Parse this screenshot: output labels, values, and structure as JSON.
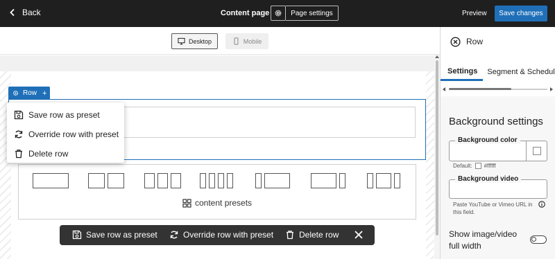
{
  "topbar": {
    "back_label": "Back",
    "page_title": "Content page",
    "page_settings_label": "Page settings",
    "preview_label": "Preview",
    "save_label": "Save changes",
    "accent_color": "#1f6fb8"
  },
  "device_switcher": {
    "desktop_label": "Desktop",
    "mobile_label": "Mobile",
    "selected": "Desktop"
  },
  "row_tab": {
    "label": "Row"
  },
  "context_menu": {
    "items": [
      {
        "label": "Save row as preset",
        "icon": "save-icon"
      },
      {
        "label": "Override row with preset",
        "icon": "sync-icon"
      },
      {
        "label": "Delete row",
        "icon": "trash-icon"
      }
    ]
  },
  "presets": {
    "label": "content presets",
    "layouts": [
      "1",
      "1-1",
      "1-1-1",
      "1-1-1-1",
      "1-3",
      "3-1",
      "1-2-1"
    ]
  },
  "bottom_toolbar": {
    "save_preset_label": "Save row as preset",
    "override_label": "Override row with preset",
    "delete_label": "Delete row"
  },
  "panel": {
    "title": "Row",
    "tabs": [
      {
        "label": "Settings",
        "active": true
      },
      {
        "label": "Segment & Schedule",
        "active": false
      }
    ],
    "section_heading": "Background settings",
    "background_color": {
      "label": "Background color",
      "default_prefix": "Default:",
      "default_value": "#ffffff"
    },
    "background_video": {
      "label": "Background video",
      "help": "Paste YouTube or Vimeo URL in this field."
    },
    "full_width": {
      "label": "Show image/video full width",
      "enabled": false
    }
  }
}
